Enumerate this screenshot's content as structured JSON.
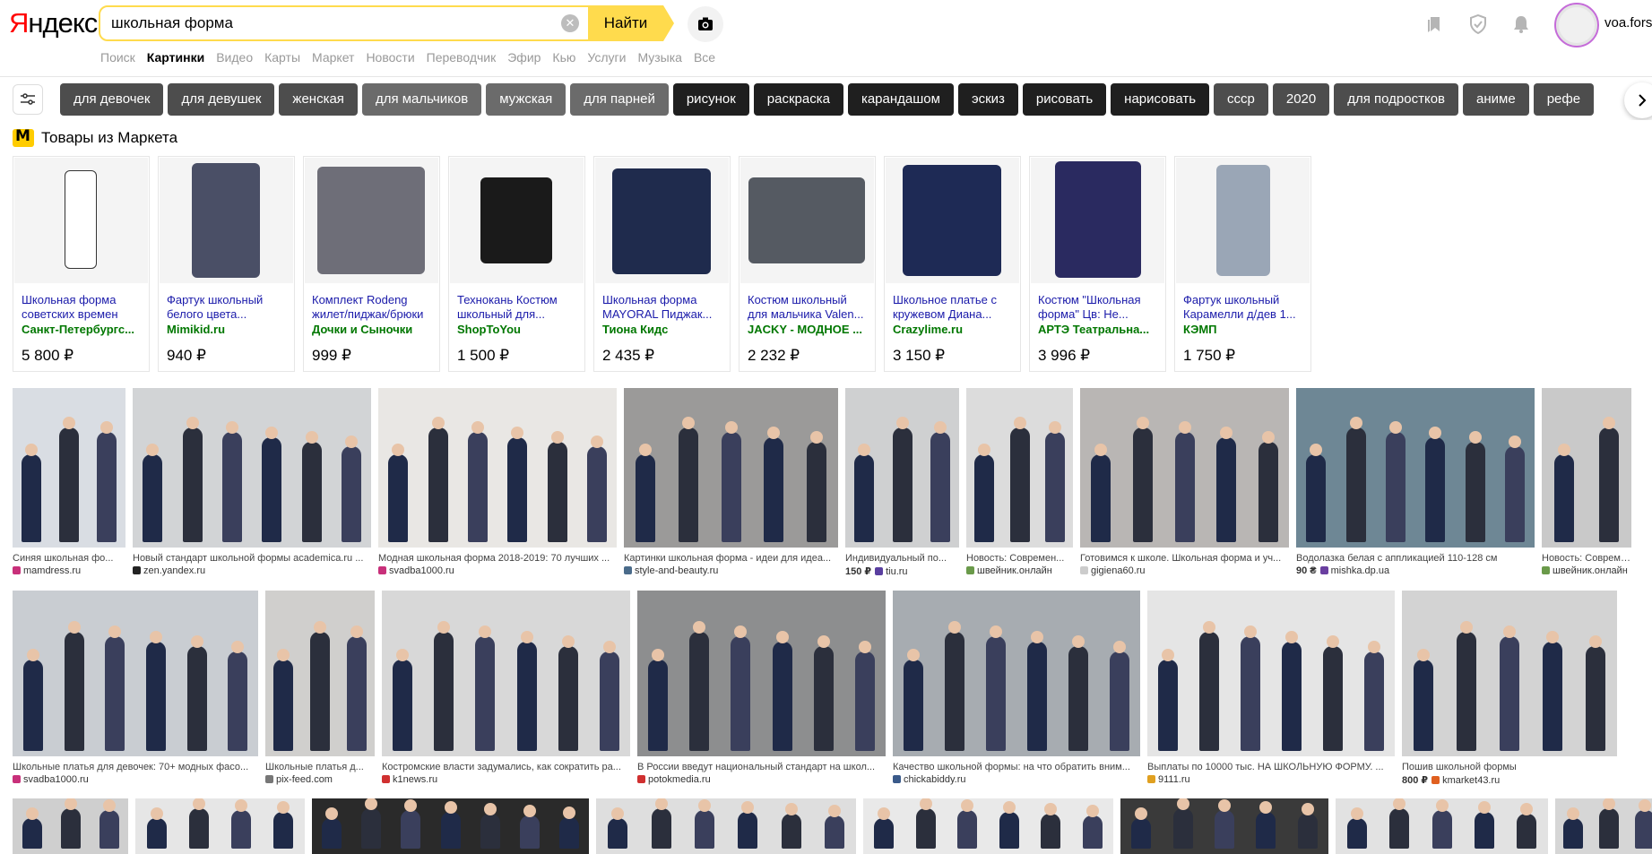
{
  "header": {
    "logo": "Яндекс",
    "search_value": "школьная форма",
    "search_button": "Найти",
    "services": [
      "Поиск",
      "Картинки",
      "Видео",
      "Карты",
      "Маркет",
      "Новости",
      "Переводчик",
      "Эфир",
      "Кью",
      "Услуги",
      "Музыка",
      "Все"
    ],
    "active_service": "Картинки",
    "user_name": "voa.fors"
  },
  "chips": [
    {
      "label": "для девочек",
      "tone": "grey"
    },
    {
      "label": "для девушек",
      "tone": "grey"
    },
    {
      "label": "женская",
      "tone": "grey"
    },
    {
      "label": "для мальчиков",
      "tone": "mid"
    },
    {
      "label": "мужская",
      "tone": "mid"
    },
    {
      "label": "для парней",
      "tone": "mid"
    },
    {
      "label": "рисунок",
      "tone": "dark"
    },
    {
      "label": "раскраска",
      "tone": "dark"
    },
    {
      "label": "карандашом",
      "tone": "dark"
    },
    {
      "label": "эскиз",
      "tone": "dark"
    },
    {
      "label": "рисовать",
      "tone": "dark"
    },
    {
      "label": "нарисовать",
      "tone": "dark"
    },
    {
      "label": "ссср",
      "tone": "grey"
    },
    {
      "label": "2020",
      "tone": "grey"
    },
    {
      "label": "для подростков",
      "tone": "grey"
    },
    {
      "label": "аниме",
      "tone": "grey"
    },
    {
      "label": "рефе",
      "tone": "grey"
    }
  ],
  "market": {
    "title": "Товары из Маркета",
    "products": [
      {
        "title": "Школьная форма советских времен",
        "shop": "Санкт-Петербургс...",
        "price": "5 800 ₽",
        "icon": "girl-uniform-photo"
      },
      {
        "title": "Фартук школьный белого цвета...",
        "shop": "Mimikid.ru",
        "price": "940 ₽",
        "icon": "apron-photo"
      },
      {
        "title": "Комплект Rodeng жилет/пиджак/брюки",
        "shop": "Дочки и Сыночки",
        "price": "999 ₽",
        "icon": "suit-set-photo"
      },
      {
        "title": "Технокань Костюм школьный для...",
        "shop": "ShopToYou",
        "price": "1 500 ₽",
        "icon": "vest-photo"
      },
      {
        "title": "Школьная форма MAYORAL Пиджак...",
        "shop": "Тиона Кидс",
        "price": "2 435 ₽",
        "icon": "blazer-photo"
      },
      {
        "title": "Костюм школьный для мальчика Valen...",
        "shop": "JACKY - МОДНОЕ ...",
        "price": "2 232 ₽",
        "icon": "boy-suit-photo"
      },
      {
        "title": "Школьное платье с кружевом Диана...",
        "shop": "Crazylime.ru",
        "price": "3 150 ₽",
        "icon": "dress-photo"
      },
      {
        "title": "Костюм \"Школьная форма\" Цв: Не...",
        "shop": "АРТЭ Театральна...",
        "price": "3 996 ₽",
        "icon": "costume-photo"
      },
      {
        "title": "Фартук школьный Карамелли д/дев 1...",
        "shop": "КЭМП",
        "price": "1 750 ₽",
        "icon": "apron-girl-photo"
      }
    ]
  },
  "images_row1": [
    {
      "caption": "Синяя школьная фо...",
      "source": "mamdress.ru",
      "price": "",
      "bg": "#d9dde3",
      "fav": "#c8307a"
    },
    {
      "caption": "Новый стандарт школьной формы academica.ru ...",
      "source": "zen.yandex.ru",
      "price": "",
      "bg": "#d2d4d6",
      "fav": "#222222"
    },
    {
      "caption": "Модная школьная форма 2018-2019: 70 лучших ...",
      "source": "svadba1000.ru",
      "price": "",
      "bg": "#e9e7e4",
      "fav": "#c8307a"
    },
    {
      "caption": "Картинки школьная форма - идеи для идеа...",
      "source": "style-and-beauty.ru",
      "price": "",
      "bg": "#9b9a99",
      "fav": "#4a6b8a"
    },
    {
      "caption": "Индивидуальный по...",
      "source": "tiu.ru",
      "price": "150 ₽",
      "bg": "#cfd0d1",
      "fav": "#5a3fa0"
    },
    {
      "caption": "Новость: Современ...",
      "source": "швейник.онлайн",
      "price": "",
      "bg": "#dcdcdc",
      "fav": "#6a9a4a"
    },
    {
      "caption": "Готовимся к школе. Школьная форма и уч...",
      "source": "gigiena60.ru",
      "price": "",
      "bg": "#b9b6b4",
      "fav": "#cccccc"
    },
    {
      "caption": "Водолазка белая с аппликацией 110-128 см",
      "source": "mishka.dp.ua",
      "price": "90 ₴",
      "bg": "#6e8795",
      "fav": "#6a3fa0"
    },
    {
      "caption": "Новость: Современ...",
      "source": "швейник.онлайн",
      "price": "",
      "bg": "#c9c9c9",
      "fav": "#6a9a4a"
    }
  ],
  "images_row2": [
    {
      "caption": "Школьные платья для девочек: 70+ модных фасо...",
      "source": "svadba1000.ru",
      "price": "",
      "bg": "#c9cdd2",
      "fav": "#c8307a"
    },
    {
      "caption": "Школьные платья д...",
      "source": "pix-feed.com",
      "price": "",
      "bg": "#d0cfcd",
      "fav": "#777777"
    },
    {
      "caption": "Костромские власти задумались, как сократить ра...",
      "source": "k1news.ru",
      "price": "",
      "bg": "#d8d8d8",
      "fav": "#d03030"
    },
    {
      "caption": "В России введут национальный стандарт на школ...",
      "source": "potokmedia.ru",
      "price": "",
      "bg": "#8d8e8f",
      "fav": "#d03030"
    },
    {
      "caption": "Качество школьной формы: на что обратить вним...",
      "source": "chickabiddy.ru",
      "price": "",
      "bg": "#a7acb1",
      "fav": "#3a5a8a"
    },
    {
      "caption": "Выплаты по 10000 тыс. НА ШКОЛЬНУЮ ФОРМУ. ...",
      "source": "9111.ru",
      "price": "",
      "bg": "#e5e5e5",
      "fav": "#e0a020"
    },
    {
      "caption": "Пошив школьной формы",
      "source": "kmarket43.ru",
      "price": "800 ₽",
      "bg": "#d3d3d3",
      "fav": "#e06020"
    }
  ],
  "images_row3": [
    {
      "bg": "#cfcfcf"
    },
    {
      "bg": "#e6e6e6"
    },
    {
      "bg": "#2a2a2a"
    },
    {
      "bg": "#dedede"
    },
    {
      "bg": "#e9e9e9"
    },
    {
      "bg": "#3a3a3a"
    },
    {
      "bg": "#e2e2e2"
    },
    {
      "bg": "#d6d6d6"
    }
  ]
}
